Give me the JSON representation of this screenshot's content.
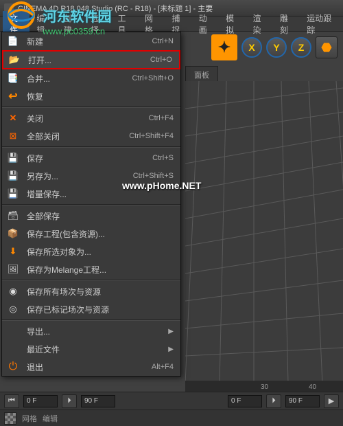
{
  "title": "CINEMA 4D R18.048 Studio (RC - R18) - [未标题 1] - 主要",
  "menubar": [
    "文件",
    "编辑",
    "创建",
    "选择",
    "工具",
    "网格",
    "捕捉",
    "动画",
    "模拟",
    "渲染",
    "雕刻",
    "运动跟踪"
  ],
  "axis": [
    "X",
    "Y",
    "Z"
  ],
  "panel_header": "面板",
  "dropdown": [
    {
      "icon": "icon-new",
      "label": "新建",
      "shortcut": "Ctrl+N"
    },
    {
      "icon": "icon-open",
      "label": "打开...",
      "shortcut": "Ctrl+O",
      "highlighted": true
    },
    {
      "icon": "icon-merge",
      "label": "合并...",
      "shortcut": "Ctrl+Shift+O"
    },
    {
      "icon": "icon-revert",
      "label": "恢复"
    },
    {
      "sep": true
    },
    {
      "icon": "icon-close",
      "label": "关闭",
      "shortcut": "Ctrl+F4"
    },
    {
      "icon": "icon-closeall",
      "label": "全部关闭",
      "shortcut": "Ctrl+Shift+F4"
    },
    {
      "sep": true
    },
    {
      "icon": "icon-save",
      "label": "保存",
      "shortcut": "Ctrl+S"
    },
    {
      "icon": "icon-saveas",
      "label": "另存为...",
      "shortcut": "Ctrl+Shift+S"
    },
    {
      "icon": "icon-incsave",
      "label": "增量保存..."
    },
    {
      "sep": true
    },
    {
      "icon": "icon-saveall",
      "label": "全部保存"
    },
    {
      "icon": "icon-saveproj",
      "label": "保存工程(包含资源)..."
    },
    {
      "icon": "icon-savesel",
      "label": "保存所选对象为..."
    },
    {
      "icon": "icon-melange",
      "label": "保存为Melange工程..."
    },
    {
      "sep": true
    },
    {
      "icon": "icon-scenes",
      "label": "保存所有场次与资源"
    },
    {
      "icon": "icon-marked",
      "label": "保存已标记场次与资源"
    },
    {
      "sep": true
    },
    {
      "icon": "",
      "label": "导出...",
      "arrow": true
    },
    {
      "icon": "",
      "label": "最近文件",
      "arrow": true
    },
    {
      "icon": "icon-quit",
      "label": "退出",
      "shortcut": "Alt+F4"
    }
  ],
  "watermark1_main": "河东软件园",
  "watermark1_sub": "www.pc0359.cn",
  "watermark2": "www.pHome.NET",
  "ruler": {
    "t30": "30",
    "t40": "40"
  },
  "bottombar": {
    "f1": "0 F",
    "f2": "90 F",
    "f3": "0 F",
    "f4": "90 F"
  },
  "statusbar": {
    "s1": "网格",
    "s2": "编辑"
  }
}
